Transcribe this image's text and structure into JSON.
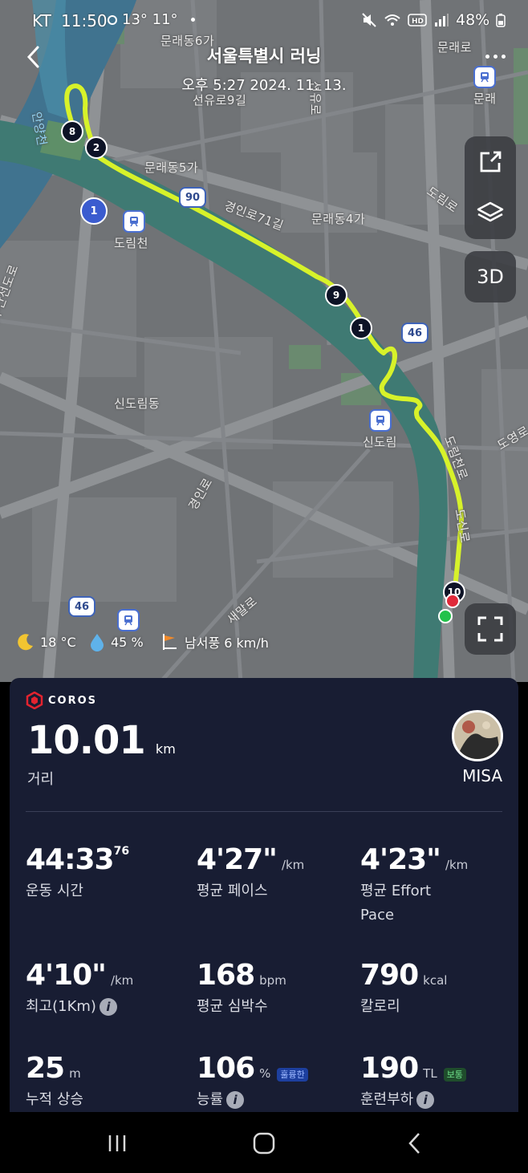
{
  "status_bar": {
    "carrier": "KT",
    "time": "11:50",
    "weather": "13° 11°",
    "battery": "48%"
  },
  "header": {
    "title": "서울특별시 러닝",
    "subtitle": "오후 5:27 2024. 11. 13."
  },
  "map": {
    "labels": [
      "문래동6가",
      "선유로9길",
      "문래로",
      "문래",
      "선유로",
      "문래동5가",
      "경인로71길",
      "문래동4가",
      "도림로",
      "도림천",
      "서부간선도로",
      "신도림동",
      "신도림",
      "도림천로",
      "도신로",
      "경인로",
      "새말로",
      "도영로",
      "안양천"
    ],
    "road_badges": [
      "90",
      "46",
      "46"
    ],
    "route_circle": "1",
    "km_markers": [
      "8",
      "2",
      "9",
      "1",
      "10"
    ],
    "buttons": {
      "three_d": "3D"
    },
    "route_color": "#d7f22a"
  },
  "weather_row": {
    "temp": "18 °C",
    "humidity": "45 %",
    "wind": "남서풍 6 km/h"
  },
  "card": {
    "brand": "COROS",
    "distance_value": "10.01",
    "distance_unit": "km",
    "distance_label": "거리",
    "user_name": "MISA",
    "stats": [
      {
        "value": "44:33",
        "sup": "76",
        "unit": "",
        "label": "운동 시간"
      },
      {
        "value": "4'27\"",
        "unit": "/km",
        "label": "평균 페이스"
      },
      {
        "value": "4'23\"",
        "unit": "/km",
        "label": "평균 Effort Pace"
      },
      {
        "value": "4'10\"",
        "unit": "/km",
        "label": "최고(1Km)"
      },
      {
        "value": "168",
        "unit": "bpm",
        "label": "평균 심박수"
      },
      {
        "value": "790",
        "unit": "kcal",
        "label": "칼로리"
      },
      {
        "value": "25",
        "unit": "m",
        "label": "누적 상승"
      },
      {
        "value": "106",
        "unit": "%",
        "tag": "훌륭한",
        "label": "능률"
      },
      {
        "value": "190",
        "unit": "TL",
        "tag": "보통",
        "label": "훈련부하"
      }
    ]
  }
}
